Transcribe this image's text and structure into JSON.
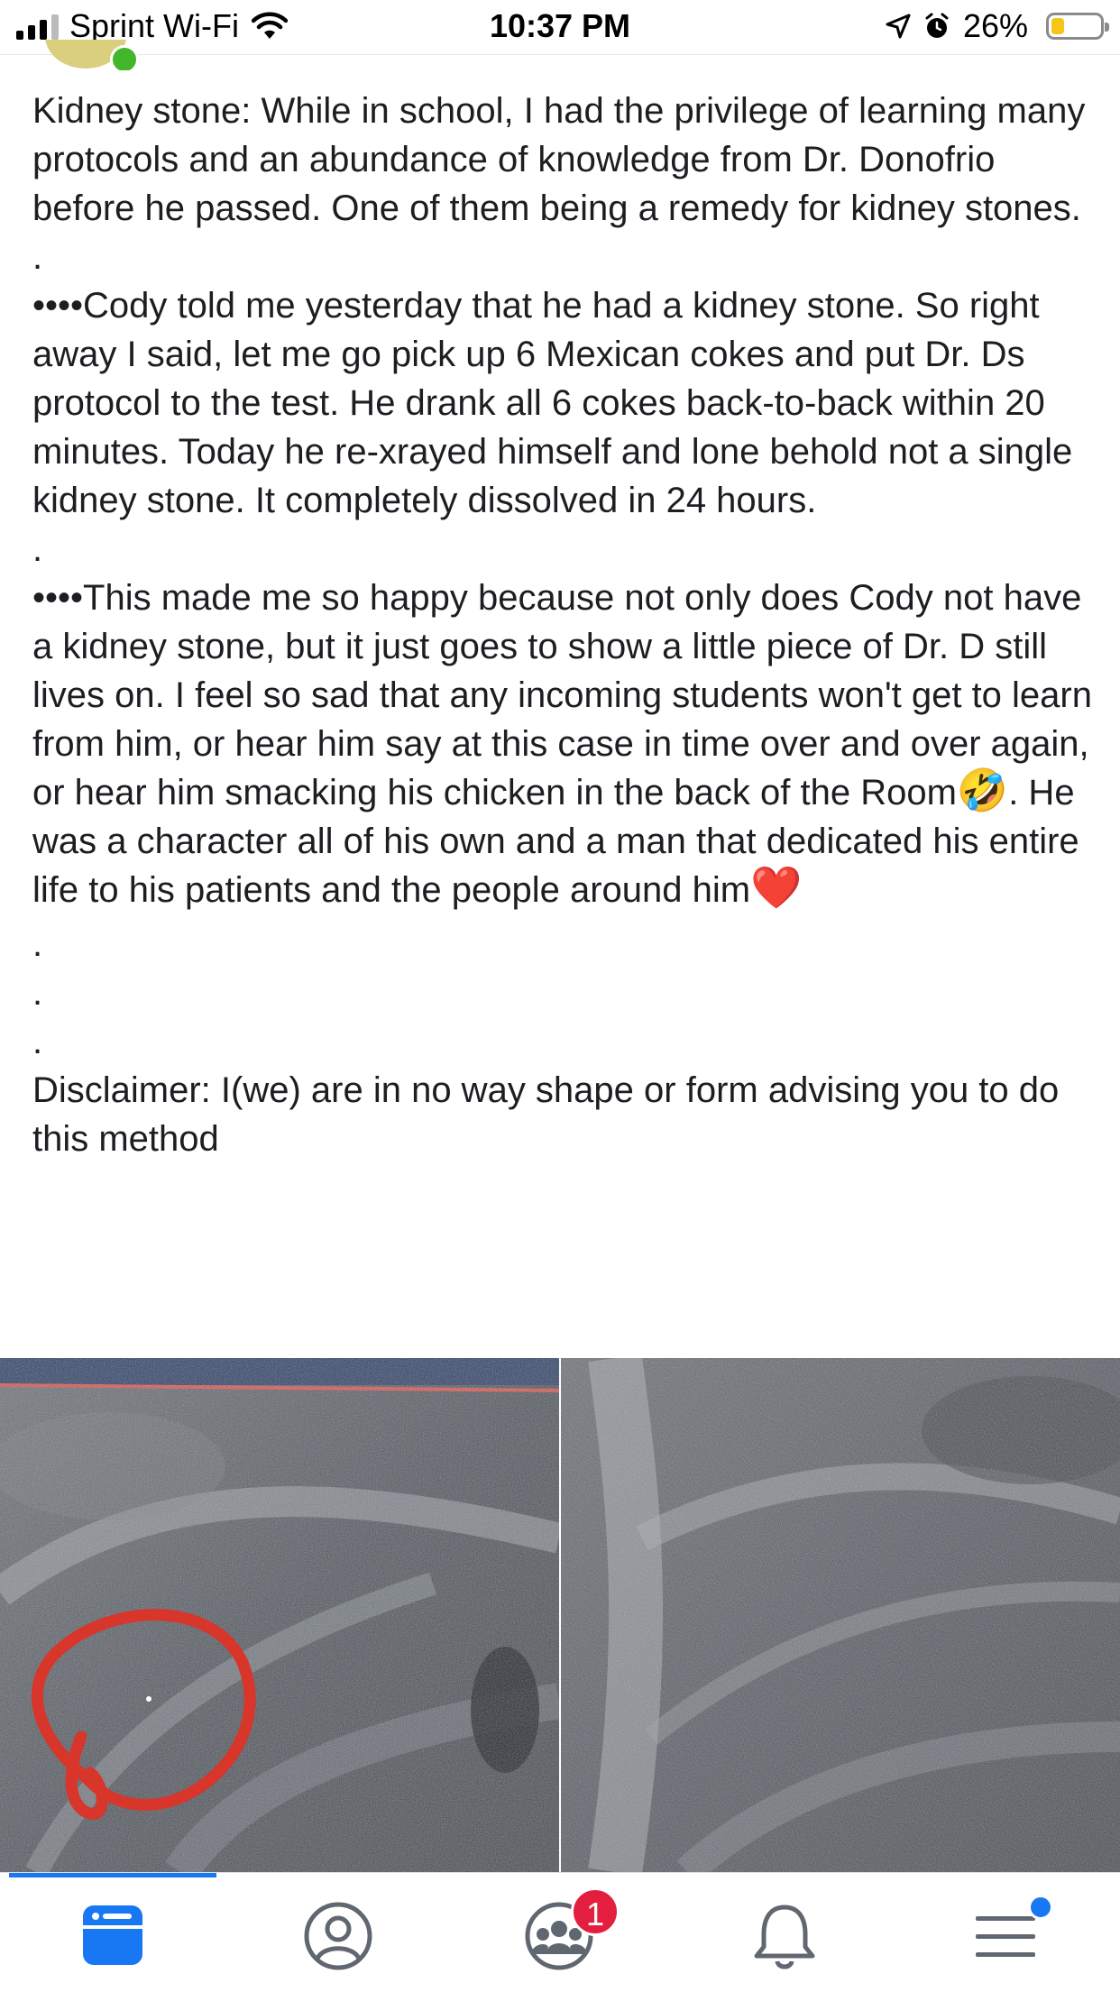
{
  "status_bar": {
    "carrier": "Sprint Wi-Fi",
    "time": "10:37 PM",
    "battery": "26%",
    "battery_level": 0.26
  },
  "post": {
    "paragraphs": [
      "Kidney stone: While in school, I had the privilege of learning many protocols and an abundance of knowledge from Dr. Donofrio before he passed. One of them being a remedy for kidney stones.",
      ".",
      "••••Cody told me yesterday that he had a kidney stone. So right away I said, let me go pick up 6 Mexican cokes and put Dr. Ds protocol to the test. He drank all 6 cokes back-to-back within 20 minutes.  Today he re-xrayed himself and lone behold not a single kidney stone. It completely dissolved in 24 hours.",
      "."
    ],
    "p5_before_emoji": "••••This made me so happy because not only does Cody not have a kidney stone, but it just goes to show a little piece of Dr. D still lives on. I feel so sad that any incoming students won't get to learn from him, or hear him say at this case in time over and over again, or hear him smacking his chicken in the back of the Room",
    "p5_emoji_1": "🤣",
    "p5_after_emoji": ". He was a character all of his own and a man that dedicated his entire life to his patients and the people around him",
    "p5_emoji_2": "❤️",
    "dots_after": [
      ".",
      ".",
      "."
    ],
    "disclaimer": "Disclaimer: I(we) are in no way shape or form advising you to do this method"
  },
  "images": [
    {
      "name": "xray-before",
      "annotation": "red-circle-around-stone"
    },
    {
      "name": "xray-after"
    }
  ],
  "tab_bar": {
    "active_tab": "news-feed",
    "groups_badge": "1",
    "accent_color": "#1877f2",
    "badge_color": "#e41e3f"
  }
}
